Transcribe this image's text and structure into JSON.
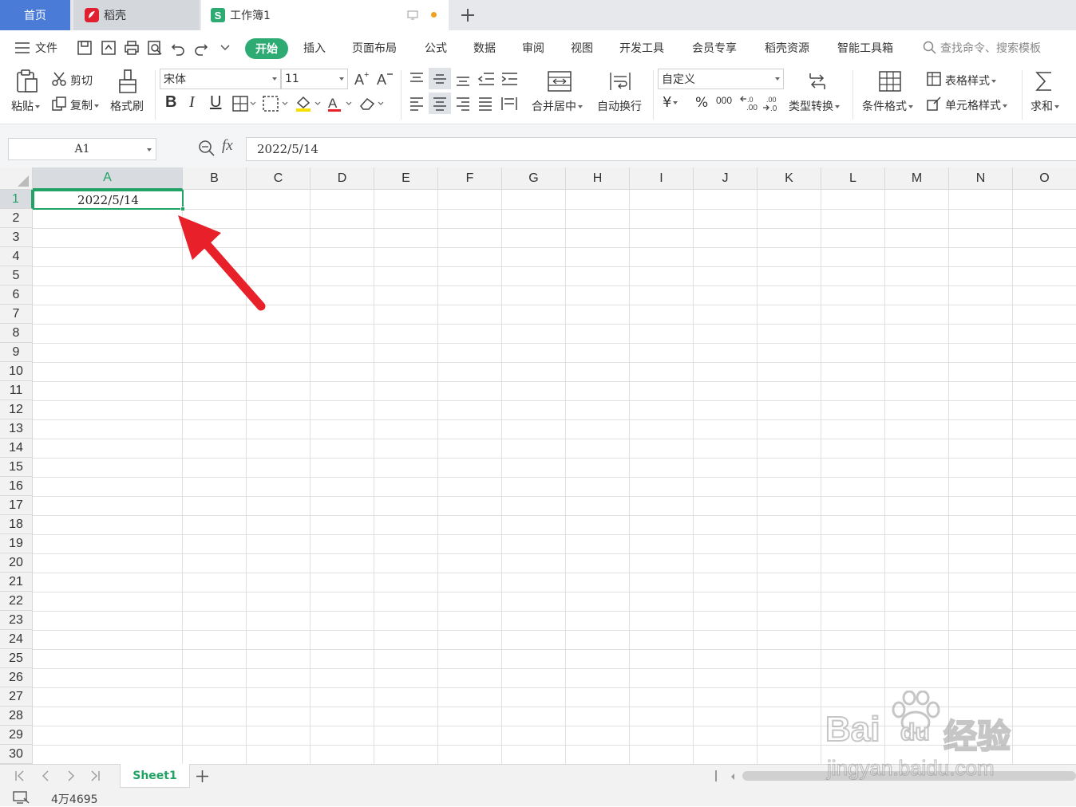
{
  "tabs": {
    "home": "首页",
    "docer": "稻壳",
    "workbook": "工作簿1"
  },
  "menu": {
    "file": "文件",
    "start": "开始",
    "insert": "插入",
    "page_layout": "页面布局",
    "formulas": "公式",
    "data": "数据",
    "review": "审阅",
    "view": "视图",
    "developer": "开发工具",
    "member": "会员专享",
    "docer_resources": "稻壳资源",
    "smart_toolbox": "智能工具箱",
    "search_placeholder": "查找命令、搜索模板"
  },
  "ribbon": {
    "paste": "粘贴",
    "cut": "剪切",
    "copy": "复制",
    "format_painter": "格式刷",
    "font_name": "宋体",
    "font_size": "11",
    "merge_center": "合并居中",
    "wrap_text": "自动换行",
    "number_format": "自定义",
    "type_convert": "类型转换",
    "conditional_format": "条件格式",
    "table_style": "表格样式",
    "cell_style": "单元格样式",
    "sum": "求和",
    "bold": "B",
    "italic": "I",
    "underline": "U",
    "currency": "¥",
    "percent": "%",
    "thousands": "000",
    "inc_decimal": ".00",
    "dec_decimal": ".0",
    "font_color_letter": "A"
  },
  "formula_bar": {
    "name_box": "A1",
    "fx": "fx",
    "value": "2022/5/14"
  },
  "grid": {
    "columns": [
      "A",
      "B",
      "C",
      "D",
      "E",
      "F",
      "G",
      "H",
      "I",
      "J",
      "K",
      "L",
      "M",
      "N",
      "O"
    ],
    "rows": [
      "1",
      "2",
      "3",
      "4",
      "5",
      "6",
      "7",
      "8",
      "9",
      "10",
      "11",
      "12",
      "13",
      "14",
      "15",
      "16",
      "17",
      "18",
      "19",
      "20",
      "21",
      "22",
      "23",
      "24",
      "25",
      "26",
      "27",
      "28",
      "29",
      "30"
    ],
    "selected_cell_value": "2022/5/14"
  },
  "sheets": {
    "active": "Sheet1"
  },
  "status": {
    "text": "4万4695"
  },
  "watermark": {
    "line1": "Bai",
    "line1b": "du",
    "line1c": "经验",
    "line2": "jingyan.baidu.com"
  },
  "colors": {
    "accent_green": "#21a366",
    "start_tab": "#2eab73",
    "home_tab": "#4a7bd6",
    "arrow_red": "#e8202a"
  }
}
